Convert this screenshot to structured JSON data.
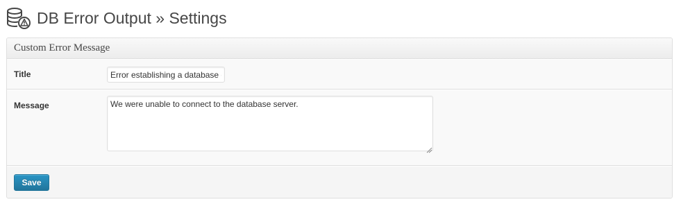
{
  "header": {
    "title": "DB Error Output » Settings",
    "icon": "database-warning-icon"
  },
  "section": {
    "title": "Custom Error Message"
  },
  "fields": {
    "title": {
      "label": "Title",
      "value": "Error establishing a database connection"
    },
    "message": {
      "label": "Message",
      "value": "We were unable to connect to the database server."
    }
  },
  "actions": {
    "save_label": "Save"
  },
  "colors": {
    "accent": "#21759b",
    "border": "#dfdfdf",
    "panel": "#f9f9f9",
    "text": "#333333"
  }
}
